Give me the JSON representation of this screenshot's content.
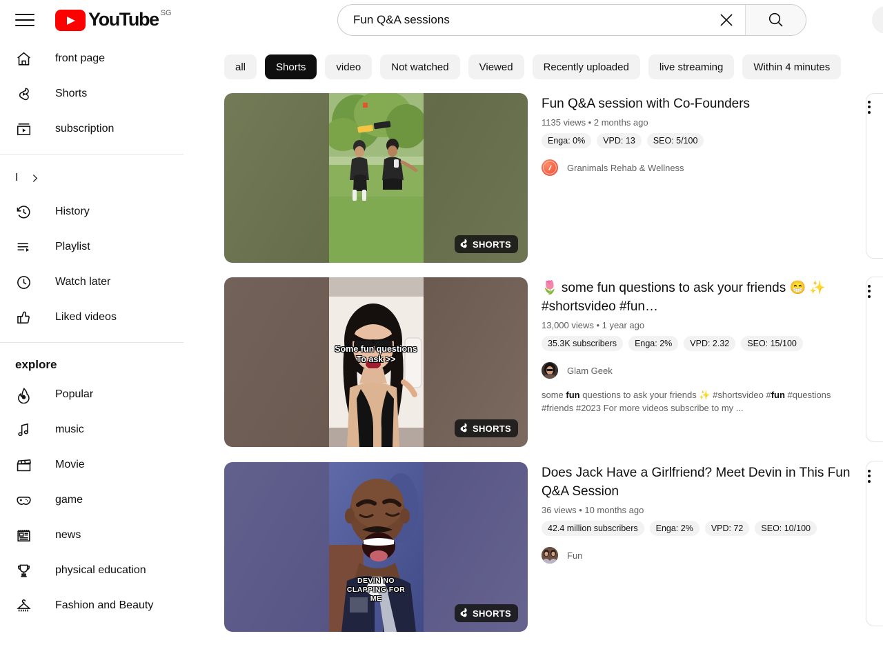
{
  "header": {
    "menu_icon": "hamburger-menu-icon",
    "logo_text": "YouTube",
    "country_code": "SG",
    "search": {
      "value": "Fun Q&A sessions",
      "placeholder": "Search",
      "clear_icon": "close-x-icon",
      "search_icon": "magnifier-icon"
    }
  },
  "sidebar": {
    "primary": [
      {
        "label": "front page",
        "icon": "home-icon"
      },
      {
        "label": "Shorts",
        "icon": "shorts-icon"
      },
      {
        "label": "subscription",
        "icon": "subscriptions-icon"
      }
    ],
    "collapsed_row": {
      "label": "I",
      "icon": "chevron-right-icon"
    },
    "library": [
      {
        "label": "History",
        "icon": "history-clock-icon"
      },
      {
        "label": "Playlist",
        "icon": "playlist-icon"
      },
      {
        "label": "Watch later",
        "icon": "clock-icon"
      },
      {
        "label": "Liked videos",
        "icon": "thumbs-up-icon"
      }
    ],
    "explore_heading": "explore",
    "explore": [
      {
        "label": "Popular",
        "icon": "trending-fire-icon"
      },
      {
        "label": "music",
        "icon": "music-note-icon"
      },
      {
        "label": "Movie",
        "icon": "clapperboard-icon"
      },
      {
        "label": "game",
        "icon": "gamepad-icon"
      },
      {
        "label": "news",
        "icon": "newspaper-icon"
      },
      {
        "label": "physical education",
        "icon": "trophy-icon"
      },
      {
        "label": "Fashion and Beauty",
        "icon": "hanger-icon"
      }
    ]
  },
  "filters": [
    {
      "label": "all",
      "active": false
    },
    {
      "label": "Shorts",
      "active": true
    },
    {
      "label": "video",
      "active": false
    },
    {
      "label": "Not watched",
      "active": false
    },
    {
      "label": "Viewed",
      "active": false
    },
    {
      "label": "Recently uploaded",
      "active": false
    },
    {
      "label": "live streaming",
      "active": false
    },
    {
      "label": "Within 4 minutes",
      "active": false
    }
  ],
  "results": [
    {
      "title": "Fun Q&A session with Co-Founders",
      "meta": "1135 views • 2 months ago",
      "badges": [
        "Enga: 0%",
        "VPD: 13",
        "SEO: 5/100"
      ],
      "channel": "Granimals Rehab & Wellness",
      "description": "",
      "overlay_text": "",
      "shorts_label": "SHORTS",
      "shorts_icon": "shorts-badge-icon",
      "kebab_icon": "more-options-icon",
      "bg_color": "#6b7350",
      "avatar_color": "#f26c4f"
    },
    {
      "title": "🌷 some fun questions to ask your friends 😁 ✨ #shortsvideo #fun…",
      "meta": "13,000 views • 1 year ago",
      "badges": [
        "35.3K subscribers",
        "Enga: 2%",
        "VPD: 2.32",
        "SEO: 15/100"
      ],
      "channel": "Glam Geek",
      "description": "some fun questions to ask your friends ✨ #shortsvideo #fun #questions #friends #2023 For more videos subscribe to my ...",
      "description_bold": [
        "fun",
        "fun"
      ],
      "overlay_text": "Some fun questions\nTo ask >>",
      "shorts_label": "SHORTS",
      "shorts_icon": "shorts-badge-icon",
      "kebab_icon": "more-options-icon",
      "bg_color": "#6b5b4e",
      "avatar_color": "#3a3230"
    },
    {
      "title": "Does Jack Have a Girlfriend? Meet Devin in This Fun Q&A Session",
      "meta": "36 views • 10 months ago",
      "badges": [
        "42.4 million subscribers",
        "Enga: 2%",
        "VPD: 72",
        "SEO: 10/100"
      ],
      "channel": "Fun",
      "description": "",
      "overlay_text": "DEVIN NO\nCLAPPING FOR\nME",
      "shorts_label": "SHORTS",
      "shorts_icon": "shorts-badge-icon",
      "kebab_icon": "more-options-icon",
      "bg_color": "#5b5880",
      "avatar_color": "#7a5a50"
    }
  ],
  "colors": {
    "brand_red": "#ff0000",
    "text_primary": "#0f0f0f",
    "text_secondary": "#606060",
    "chip_bg": "#f2f2f2",
    "chip_active_bg": "#0f0f0f"
  }
}
